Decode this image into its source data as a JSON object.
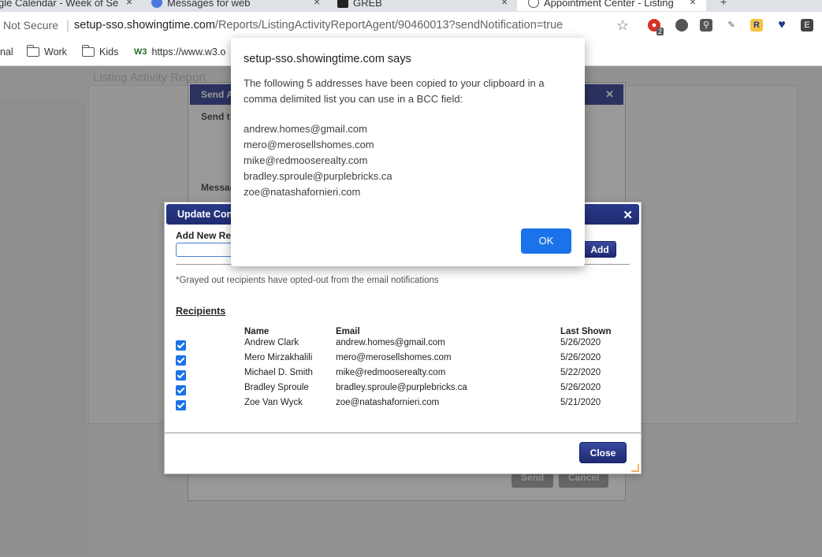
{
  "browser": {
    "tabs": [
      {
        "label": "gle Calendar - Week of Se"
      },
      {
        "label": "Messages for web"
      },
      {
        "label": "GREB"
      },
      {
        "label": "Appointment Center - Listing"
      }
    ],
    "security_label": "Not Secure",
    "url_host": "setup-sso.showingtime.com",
    "url_path": "/Reports/ListingActivityReportAgent/90460013?sendNotification=true",
    "extension_badge": "2",
    "bookmarks": [
      {
        "label": "nal"
      },
      {
        "label": "Work"
      },
      {
        "label": "Kids"
      },
      {
        "label": "https://www.w3.o"
      }
    ]
  },
  "background_page": {
    "title": "Listing Activity Report",
    "send_dialog_title": "Send A",
    "send_to_label": "Send t",
    "message_label": "Messag",
    "send_button": "Send",
    "cancel_button": "Cancel"
  },
  "update_dialog": {
    "title": "Update Cont",
    "add_label": "Add New Re",
    "add_button": "Add",
    "note": "*Grayed out recipients have opted-out from the email notifications",
    "recipients_heading": "Recipients",
    "columns": {
      "name": "Name",
      "email": "Email",
      "last_shown": "Last Shown"
    },
    "rows": [
      {
        "name": "Andrew Clark",
        "email": "andrew.homes@gmail.com",
        "last_shown": "5/26/2020",
        "checked": true
      },
      {
        "name": "Mero Mirzakhalili",
        "email": "mero@merosellshomes.com",
        "last_shown": "5/26/2020",
        "checked": true
      },
      {
        "name": "Michael D. Smith",
        "email": "mike@redmooserealty.com",
        "last_shown": "5/22/2020",
        "checked": true
      },
      {
        "name": "Bradley Sproule",
        "email": "bradley.sproule@purplebricks.ca",
        "last_shown": "5/26/2020",
        "checked": true
      },
      {
        "name": "Zoe Van Wyck",
        "email": "zoe@natashafornieri.com",
        "last_shown": "5/21/2020",
        "checked": true
      }
    ],
    "close_button": "Close"
  },
  "alert": {
    "title": "setup-sso.showingtime.com says",
    "message": "The following 5 addresses have been copied to your clipboard in a comma delimited list you can use in a BCC field:",
    "addresses": [
      "andrew.homes@gmail.com",
      "mero@merosellshomes.com",
      "mike@redmooserealty.com",
      "bradley.sproule@purplebricks.ca",
      "zoe@natashafornieri.com"
    ],
    "ok_button": "OK"
  },
  "colors": {
    "accent": "#1a73e8",
    "dialog_title": "#1f2c72"
  }
}
